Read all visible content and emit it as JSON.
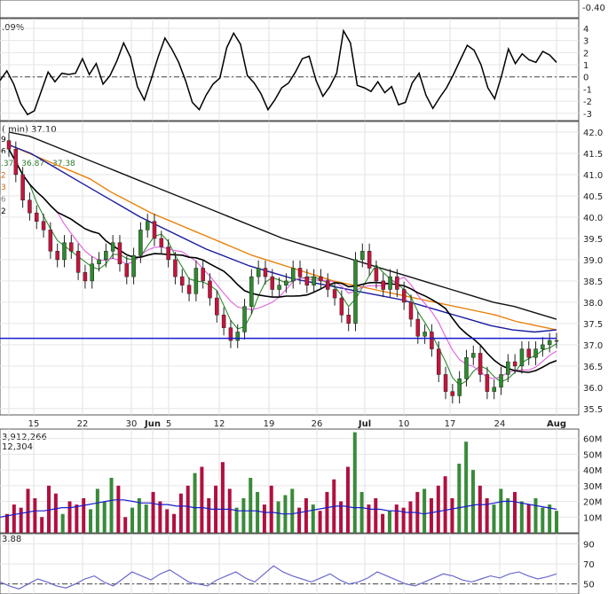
{
  "chart_data": [
    {
      "type": "line",
      "panel": "momentum-oscillator",
      "title": ".09%",
      "ylim": [
        -3.6,
        4.8
      ],
      "yticks": [
        "4",
        "3",
        "2",
        "1",
        "0",
        "-1",
        "-2",
        "-3"
      ],
      "top_strip_tick": "-0.40",
      "zero_line": 0,
      "series": [
        {
          "values": [
            -0.3,
            0.5,
            -0.6,
            -2.2,
            -3.1,
            -2.8,
            -1.2,
            0.4,
            -0.4,
            0.3,
            0.2,
            0.3,
            1.5,
            0.2,
            1.1,
            -0.6,
            0.1,
            1.3,
            2.8,
            1.6,
            -0.8,
            -1.9,
            -0.2,
            1.6,
            3.2,
            2.3,
            1.2,
            -0.3,
            -2.1,
            -2.7,
            -1.5,
            -0.6,
            -0.1,
            2.4,
            3.6,
            2.7,
            0.1,
            -0.5,
            -1.4,
            -2.7,
            -1.9,
            -0.9,
            -0.5,
            0.4,
            1.5,
            1.7,
            -0.3,
            -1.6,
            -0.8,
            0.3,
            3.8,
            2.8,
            -0.7,
            -0.9,
            -1.2,
            -0.4,
            -1.3,
            -0.8,
            -2.3,
            -2.1,
            -0.5,
            0.3,
            -1.5,
            -2.6,
            -1.7,
            -0.9,
            0.2,
            1.4,
            2.6,
            2.2,
            1.0,
            -0.9,
            -1.8,
            0.1,
            2.3,
            1.1,
            1.9,
            1.4,
            1.2,
            2.1,
            1.8,
            1.2
          ]
        }
      ]
    },
    {
      "type": "line",
      "panel": "price",
      "title": "(  min) 37.10",
      "ylim": [
        35.35,
        42.25
      ],
      "yticks": [
        "42.0",
        "41.5",
        "41.0",
        "40.5",
        "40.0",
        "39.5",
        "39.0",
        "38.5",
        "38.0",
        "37.5",
        "37.0",
        "36.5",
        "36.0",
        "35.5"
      ],
      "legend_fragments": [
        "9",
        "6",
        ".37 - 36.87 - 37.38",
        "2",
        "3",
        "6",
        "2"
      ],
      "horizontal_line": 37.15,
      "x_tick_labels": [
        "15",
        "22",
        "30",
        "Jun",
        "5",
        "12",
        "19",
        "26",
        "Jul",
        "10",
        "17",
        "24",
        "Aug"
      ],
      "close": [
        41.6,
        41.0,
        40.4,
        40.1,
        39.9,
        39.7,
        39.2,
        39.0,
        39.4,
        39.2,
        38.7,
        38.5,
        38.9,
        39.0,
        39.2,
        39.4,
        38.9,
        38.6,
        39.1,
        39.7,
        39.9,
        39.5,
        39.3,
        39.0,
        38.6,
        38.4,
        38.2,
        38.8,
        38.5,
        38.1,
        37.7,
        37.4,
        37.1,
        37.3,
        37.9,
        38.6,
        38.8,
        38.6,
        38.3,
        38.4,
        38.5,
        38.8,
        38.6,
        38.4,
        38.6,
        38.5,
        38.3,
        38.1,
        37.7,
        37.5,
        39.0,
        39.2,
        38.8,
        38.5,
        38.3,
        38.6,
        38.3,
        38.0,
        37.6,
        37.2,
        37.3,
        36.9,
        36.3,
        35.9,
        35.8,
        36.2,
        36.7,
        36.8,
        36.3,
        35.9,
        36.0,
        36.3,
        36.6,
        36.5,
        36.9,
        36.7,
        36.9,
        37.0,
        37.1,
        37.1
      ],
      "series": [
        {
          "values": [
            42.0,
            41.9,
            41.7,
            41.5,
            41.3,
            41.1,
            40.9,
            40.7,
            40.5,
            40.3,
            40.1,
            39.9,
            39.7,
            39.5,
            39.35,
            39.2,
            39.05,
            38.9,
            38.75,
            38.6,
            38.45,
            38.3,
            38.15,
            38.0,
            37.9,
            37.75,
            37.6
          ]
        },
        {
          "values": [
            41.7,
            41.5,
            41.3,
            41.1,
            40.9,
            40.6,
            40.35,
            40.1,
            39.9,
            39.7,
            39.5,
            39.3,
            39.1,
            38.95,
            38.8,
            38.65,
            38.5,
            38.4,
            38.3,
            38.2,
            38.1,
            38.0,
            37.9,
            37.8,
            37.7,
            37.55,
            37.45,
            37.35
          ]
        },
        {
          "values": [
            41.7,
            41.5,
            41.2,
            40.9,
            40.6,
            40.3,
            40.0,
            39.75,
            39.5,
            39.25,
            39.05,
            38.85,
            38.7,
            38.55,
            38.45,
            38.35,
            38.25,
            38.15,
            38.05,
            37.9,
            37.75,
            37.6,
            37.45,
            37.35,
            37.3,
            37.35
          ]
        }
      ]
    },
    {
      "type": "bar",
      "panel": "volume",
      "title": "3,912,266",
      "subtitle": "12,304",
      "ylim": [
        0,
        66000000
      ],
      "yticks": [
        "60M",
        "50M",
        "40M",
        "30M",
        "20M",
        "10M"
      ],
      "values": [
        12,
        18,
        16,
        28,
        22,
        10,
        30,
        25,
        12,
        20,
        18,
        22,
        15,
        28,
        20,
        35,
        30,
        10,
        16,
        22,
        18,
        26,
        20,
        15,
        12,
        25,
        30,
        38,
        42,
        22,
        30,
        45,
        28,
        16,
        22,
        35,
        26,
        18,
        30,
        20,
        24,
        28,
        16,
        22,
        18,
        14,
        26,
        34,
        20,
        42,
        64,
        26,
        18,
        22,
        12,
        14,
        18,
        16,
        20,
        26,
        28,
        22,
        30,
        36,
        22,
        44,
        58,
        40,
        30,
        22,
        18,
        28,
        22,
        26,
        20,
        18,
        22,
        16,
        18,
        14
      ],
      "unit": "M",
      "series": [
        {
          "values": [
            10,
            11,
            12,
            13,
            14,
            14,
            15,
            16,
            16,
            17,
            18,
            19,
            20,
            21,
            21,
            20,
            19,
            19,
            18,
            18,
            17,
            17,
            16,
            16,
            15,
            15,
            15,
            14,
            14,
            14,
            13,
            13,
            12,
            12,
            13,
            14,
            15,
            16,
            17,
            17,
            16,
            16,
            15,
            15,
            14,
            14,
            13,
            13,
            12,
            13,
            14,
            15,
            16,
            17,
            18,
            18,
            19,
            20,
            20,
            19,
            18,
            17,
            16,
            15
          ]
        }
      ]
    },
    {
      "type": "line",
      "panel": "rsi",
      "title": "3.88",
      "ylim": [
        40,
        100
      ],
      "yticks": [
        "90",
        "70",
        "50"
      ],
      "series": [
        {
          "values": [
            52,
            48,
            45,
            50,
            55,
            52,
            48,
            46,
            50,
            55,
            58,
            52,
            48,
            55,
            62,
            58,
            54,
            60,
            64,
            58,
            52,
            50,
            48,
            54,
            58,
            62,
            56,
            52,
            60,
            68,
            62,
            58,
            55,
            52,
            56,
            60,
            54,
            50,
            52,
            56,
            62,
            58,
            54,
            50,
            48,
            52,
            56,
            60,
            58,
            54,
            52,
            55,
            58,
            56,
            60,
            62,
            58,
            55,
            57,
            60
          ]
        }
      ]
    }
  ]
}
